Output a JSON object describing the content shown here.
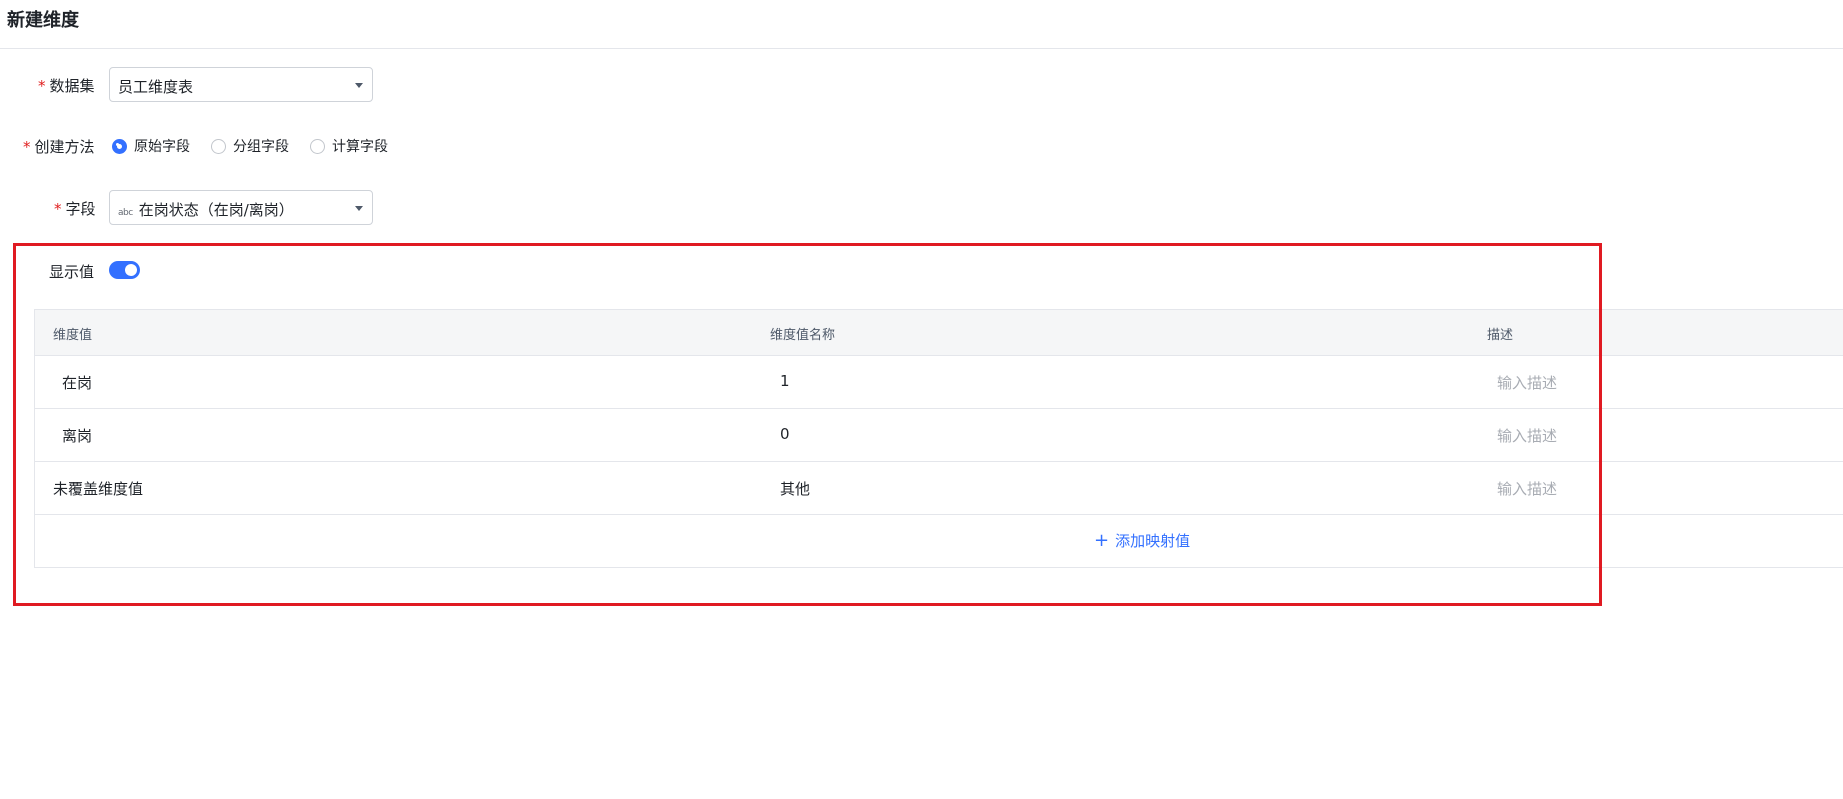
{
  "header": {
    "title": "新建维度"
  },
  "form": {
    "required_mark": "*",
    "dataset": {
      "label": "数据集",
      "value": "员工维度表"
    },
    "method": {
      "label": "创建方法",
      "options": [
        {
          "label": "原始字段",
          "selected": true
        },
        {
          "label": "分组字段",
          "selected": false
        },
        {
          "label": "计算字段",
          "selected": false
        }
      ]
    },
    "field": {
      "label": "字段",
      "type_tag": "abc",
      "value": "在岗状态（在岗/离岗）"
    },
    "display_value": {
      "label": "显示值",
      "enabled": true
    }
  },
  "table": {
    "columns": [
      "维度值",
      "维度值名称",
      "描述"
    ],
    "rows": [
      {
        "value": "在岗",
        "name": "1",
        "description_placeholder": "输入描述"
      },
      {
        "value": "离岗",
        "name": "0",
        "description_placeholder": "输入描述"
      },
      {
        "value": "未覆盖维度值",
        "name": "其他",
        "description_placeholder": "输入描述"
      }
    ],
    "add_label": "添加映射值"
  },
  "colors": {
    "accent": "#3370ff",
    "required": "#e02020",
    "highlight": "#e01a22"
  }
}
